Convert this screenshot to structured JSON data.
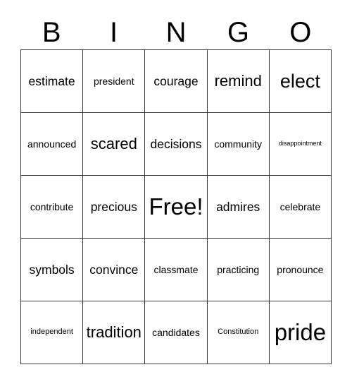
{
  "card": {
    "title": "BINGO",
    "header_letters": [
      "B",
      "I",
      "N",
      "G",
      "O"
    ],
    "free_space": "Free!",
    "rows": [
      [
        {
          "label": "estimate",
          "size": "md"
        },
        {
          "label": "president",
          "size": "sm"
        },
        {
          "label": "courage",
          "size": "md"
        },
        {
          "label": "remind",
          "size": "lg"
        },
        {
          "label": "elect",
          "size": "xl"
        }
      ],
      [
        {
          "label": "announced",
          "size": "sm"
        },
        {
          "label": "scared",
          "size": "lg"
        },
        {
          "label": "decisions",
          "size": "md"
        },
        {
          "label": "community",
          "size": "sm"
        },
        {
          "label": "disappointment",
          "size": "xxs"
        }
      ],
      [
        {
          "label": "contribute",
          "size": "sm"
        },
        {
          "label": "precious",
          "size": "md"
        },
        {
          "label": "Free!",
          "size": "xxl"
        },
        {
          "label": "admires",
          "size": "md"
        },
        {
          "label": "celebrate",
          "size": "sm"
        }
      ],
      [
        {
          "label": "symbols",
          "size": "md"
        },
        {
          "label": "convince",
          "size": "md"
        },
        {
          "label": "classmate",
          "size": "sm"
        },
        {
          "label": "practicing",
          "size": "sm"
        },
        {
          "label": "pronounce",
          "size": "sm"
        }
      ],
      [
        {
          "label": "independent",
          "size": "xs"
        },
        {
          "label": "tradition",
          "size": "lg"
        },
        {
          "label": "candidates",
          "size": "sm"
        },
        {
          "label": "Constitution",
          "size": "xs"
        },
        {
          "label": "pride",
          "size": "xxl"
        }
      ]
    ],
    "colors": {
      "background": "#ffffff",
      "text": "#000000",
      "border": "#3a3a3a"
    }
  }
}
